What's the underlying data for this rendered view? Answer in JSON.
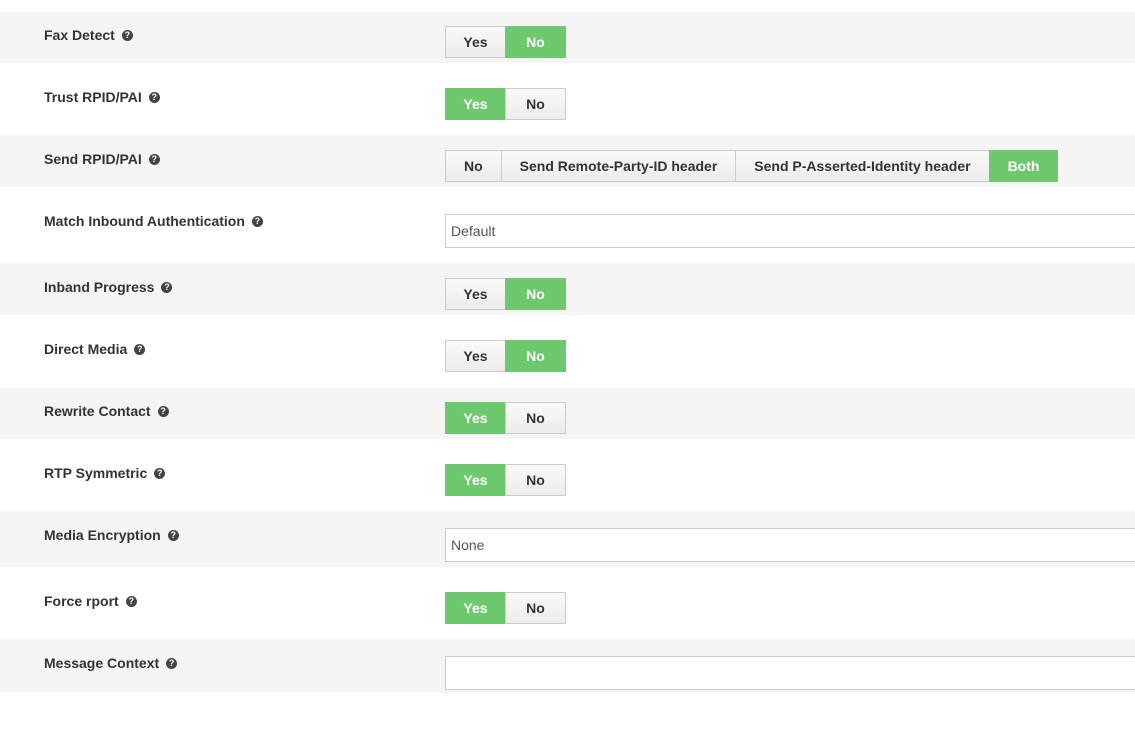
{
  "rows": [
    {
      "label": "Fax Detect",
      "type": "toggle",
      "options": [
        "Yes",
        "No"
      ],
      "selected": "No"
    },
    {
      "label": "Trust RPID/PAI",
      "type": "toggle",
      "options": [
        "Yes",
        "No"
      ],
      "selected": "Yes"
    },
    {
      "label": "Send RPID/PAI",
      "type": "toggle",
      "options": [
        "No",
        "Send Remote-Party-ID header",
        "Send P-Asserted-Identity header",
        "Both"
      ],
      "selected": "Both"
    },
    {
      "label": "Match Inbound Authentication",
      "type": "select",
      "value": "Default"
    },
    {
      "label": "Inband Progress",
      "type": "toggle",
      "options": [
        "Yes",
        "No"
      ],
      "selected": "No"
    },
    {
      "label": "Direct Media",
      "type": "toggle",
      "options": [
        "Yes",
        "No"
      ],
      "selected": "No"
    },
    {
      "label": "Rewrite Contact",
      "type": "toggle",
      "options": [
        "Yes",
        "No"
      ],
      "selected": "Yes"
    },
    {
      "label": "RTP Symmetric",
      "type": "toggle",
      "options": [
        "Yes",
        "No"
      ],
      "selected": "Yes"
    },
    {
      "label": "Media Encryption",
      "type": "select",
      "value": "None"
    },
    {
      "label": "Force rport",
      "type": "toggle",
      "options": [
        "Yes",
        "No"
      ],
      "selected": "Yes"
    },
    {
      "label": "Message Context",
      "type": "input",
      "value": ""
    }
  ],
  "help_icon": "question-circle-icon",
  "colors": {
    "active": "#6ec96e",
    "shaded_row": "#f5f5f5"
  }
}
